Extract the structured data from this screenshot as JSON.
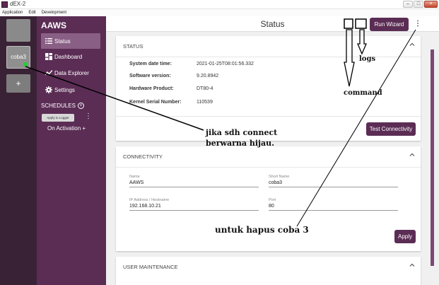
{
  "window": {
    "title": "dEX-2",
    "min": "–",
    "max": "□",
    "close": "×"
  },
  "menu": [
    "Application",
    "Edit",
    "Development"
  ],
  "devices": {
    "selected_label": "coba3",
    "add_label": "+"
  },
  "sidebar": {
    "brand": "AAWS",
    "items": [
      {
        "label": "Status",
        "icon": "list-icon"
      },
      {
        "label": "Dashboard",
        "icon": "dashboard-icon"
      },
      {
        "label": "Data Explorer",
        "icon": "chart-line-icon"
      },
      {
        "label": "Settings",
        "icon": "gear-icon"
      }
    ],
    "schedules_label": "SCHEDULES",
    "schedules_add": "+",
    "apply_to_logger": "Apply to Logger",
    "kebab": "⋮",
    "on_activation": "On Activation",
    "on_activation_add": "+"
  },
  "header": {
    "title": "Status",
    "run_wizard": "Run Wizard",
    "kebab": "⋮"
  },
  "status_card": {
    "title": "STATUS",
    "rows": [
      {
        "key": "System date time:",
        "value": "2021-01-25T08:01:56.332"
      },
      {
        "key": "Software version:",
        "value": "9.20.8942"
      },
      {
        "key": "Hardware Product:",
        "value": "DT80-4"
      },
      {
        "key": "Kernel Serial Number:",
        "value": "110539"
      }
    ],
    "test_connectivity": "Test Connectivity"
  },
  "connectivity_card": {
    "title": "CONNECTIVITY",
    "fields": [
      {
        "label": "Name",
        "value": "AAWS"
      },
      {
        "label": "Short Name",
        "value": "coba3"
      },
      {
        "label": "IP Address / Hostname",
        "value": "192.168.10.21"
      },
      {
        "label": "Port",
        "value": "80"
      }
    ],
    "apply": "Apply"
  },
  "user_card": {
    "title": "USER MAINTENANCE"
  },
  "annotations": {
    "logs": "logs",
    "command": "command",
    "jika_line1": "jika sdh connect",
    "jika_line2": "berwarna hijau.",
    "hapus": "untuk hapus coba 3"
  },
  "colors": {
    "accent": "#5b2d55",
    "rail": "#3a2236",
    "connected": "#1fcf35"
  }
}
